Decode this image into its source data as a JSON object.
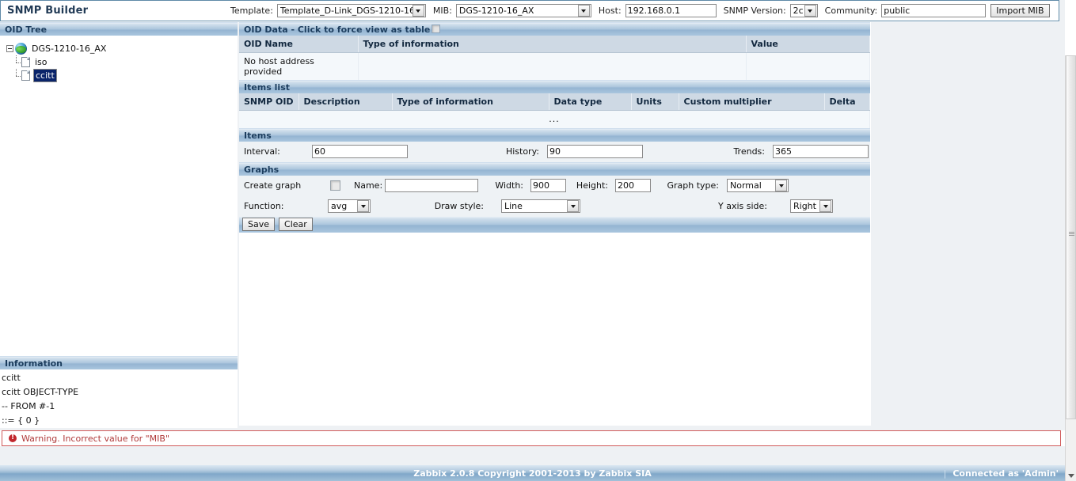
{
  "app": {
    "title": "SNMP Builder"
  },
  "toolbar": {
    "template_label": "Template:",
    "template_value": "Template_D-Link_DGS-1210-16",
    "mib_label": "MIB:",
    "mib_value": "DGS-1210-16_AX",
    "host_label": "Host:",
    "host_value": "192.168.0.1",
    "snmp_version_label": "SNMP Version:",
    "snmp_version_value": "2c",
    "community_label": "Community:",
    "community_value": "public",
    "import_mib_label": "Import MIB"
  },
  "oid_tree": {
    "title": "OID Tree",
    "root": {
      "label": "DGS-1210-16_AX",
      "icon": "globe-icon",
      "expanded": true
    },
    "children": [
      {
        "label": "iso",
        "icon": "document-icon",
        "selected": false
      },
      {
        "label": "ccitt",
        "icon": "document-icon",
        "selected": true
      }
    ]
  },
  "oid_data": {
    "title": "OID Data - Click to force view as table",
    "checkbox_checked": false,
    "columns": [
      "OID Name",
      "Type of information",
      "Value"
    ],
    "rows": [
      {
        "oid_name": "No host address provided",
        "type_of_information": "",
        "value": ""
      }
    ]
  },
  "items_list": {
    "title": "Items list",
    "columns": [
      "SNMP OID",
      "Description",
      "Type of information",
      "Data type",
      "Units",
      "Custom multiplier",
      "Delta"
    ],
    "empty_row": "..."
  },
  "items": {
    "title": "Items",
    "interval_label": "Interval:",
    "interval_value": "60",
    "history_label": "History:",
    "history_value": "90",
    "trends_label": "Trends:",
    "trends_value": "365"
  },
  "graphs": {
    "title": "Graphs",
    "create_graph_label": "Create graph",
    "create_graph_checked": false,
    "name_label": "Name:",
    "name_value": "",
    "width_label": "Width:",
    "width_value": "900",
    "height_label": "Height:",
    "height_value": "200",
    "graph_type_label": "Graph type:",
    "graph_type_value": "Normal",
    "function_label": "Function:",
    "function_value": "avg",
    "draw_style_label": "Draw style:",
    "draw_style_value": "Line",
    "y_axis_side_label": "Y axis side:",
    "y_axis_side_value": "Right",
    "save_label": "Save",
    "clear_label": "Clear"
  },
  "information": {
    "title": "Information",
    "lines": [
      "ccitt",
      "ccitt OBJECT-TYPE",
      "-- FROM #-1",
      "::= { 0 }"
    ]
  },
  "warning": {
    "icon": "error-icon",
    "text": "Warning. Incorrect value for \"MIB\""
  },
  "footer": {
    "copyright": "Zabbix 2.0.8 Copyright 2001-2013 by Zabbix SIA",
    "separator": "|",
    "connected_as": "Connected as 'Admin'"
  }
}
